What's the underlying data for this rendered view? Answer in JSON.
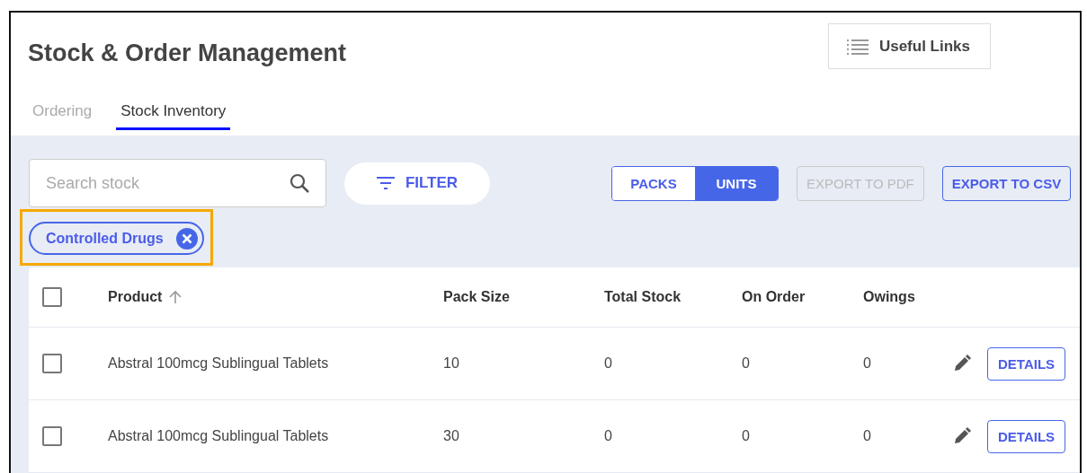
{
  "title": "Stock & Order Management",
  "useful_links": {
    "label": "Useful Links"
  },
  "tabs": [
    {
      "label": "Ordering",
      "selected": false
    },
    {
      "label": "Stock Inventory",
      "selected": true
    }
  ],
  "search": {
    "placeholder": "Search stock"
  },
  "filter_button": {
    "label": "FILTER"
  },
  "unit_toggle": [
    {
      "label": "PACKS",
      "selected": false
    },
    {
      "label": "UNITS",
      "selected": true
    }
  ],
  "export_buttons": [
    {
      "label": "EXPORT TO PDF",
      "disabled": true
    },
    {
      "label": "EXPORT TO CSV",
      "disabled": false
    }
  ],
  "filter_chips": [
    {
      "label": "Controlled Drugs",
      "highlighted": true
    }
  ],
  "table": {
    "select_all_checked": false,
    "columns": [
      {
        "label": "Product",
        "sorted": true
      },
      {
        "label": "Pack Size",
        "sorted": false
      },
      {
        "label": "Total Stock",
        "sorted": false
      },
      {
        "label": "On Order",
        "sorted": false
      },
      {
        "label": "Owings",
        "sorted": false
      }
    ],
    "rows": [
      {
        "checked": false,
        "cells": [
          "Abstral 100mcg Sublingual Tablets",
          "10",
          "0",
          "0",
          "0"
        ],
        "action": "DETAILS"
      },
      {
        "checked": false,
        "cells": [
          "Abstral 100mcg Sublingual Tablets",
          "30",
          "0",
          "0",
          "0"
        ],
        "action": "DETAILS"
      }
    ]
  }
}
